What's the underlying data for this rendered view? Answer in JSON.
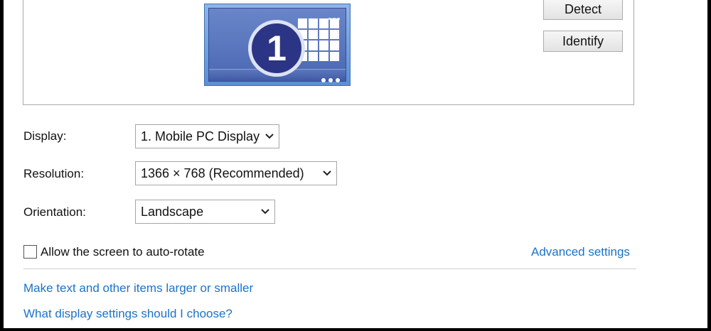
{
  "buttons": {
    "detect": "Detect",
    "identify": "Identify"
  },
  "monitor": {
    "number": "1"
  },
  "display": {
    "label": "Display:",
    "value": "1. Mobile PC Display"
  },
  "resolution": {
    "label": "Resolution:",
    "value": "1366 × 768 (Recommended)"
  },
  "orientation": {
    "label": "Orientation:",
    "value": "Landscape"
  },
  "auto_rotate": {
    "label": "Allow the screen to auto-rotate",
    "checked": false
  },
  "links": {
    "advanced": "Advanced settings",
    "text_size": "Make text and other items larger or smaller",
    "help": "What display settings should I choose?"
  },
  "colors": {
    "link": "#1a73c9",
    "monitor_disk": "#2c3585"
  },
  "icons": {
    "dropdown": "chevron-down-icon"
  }
}
